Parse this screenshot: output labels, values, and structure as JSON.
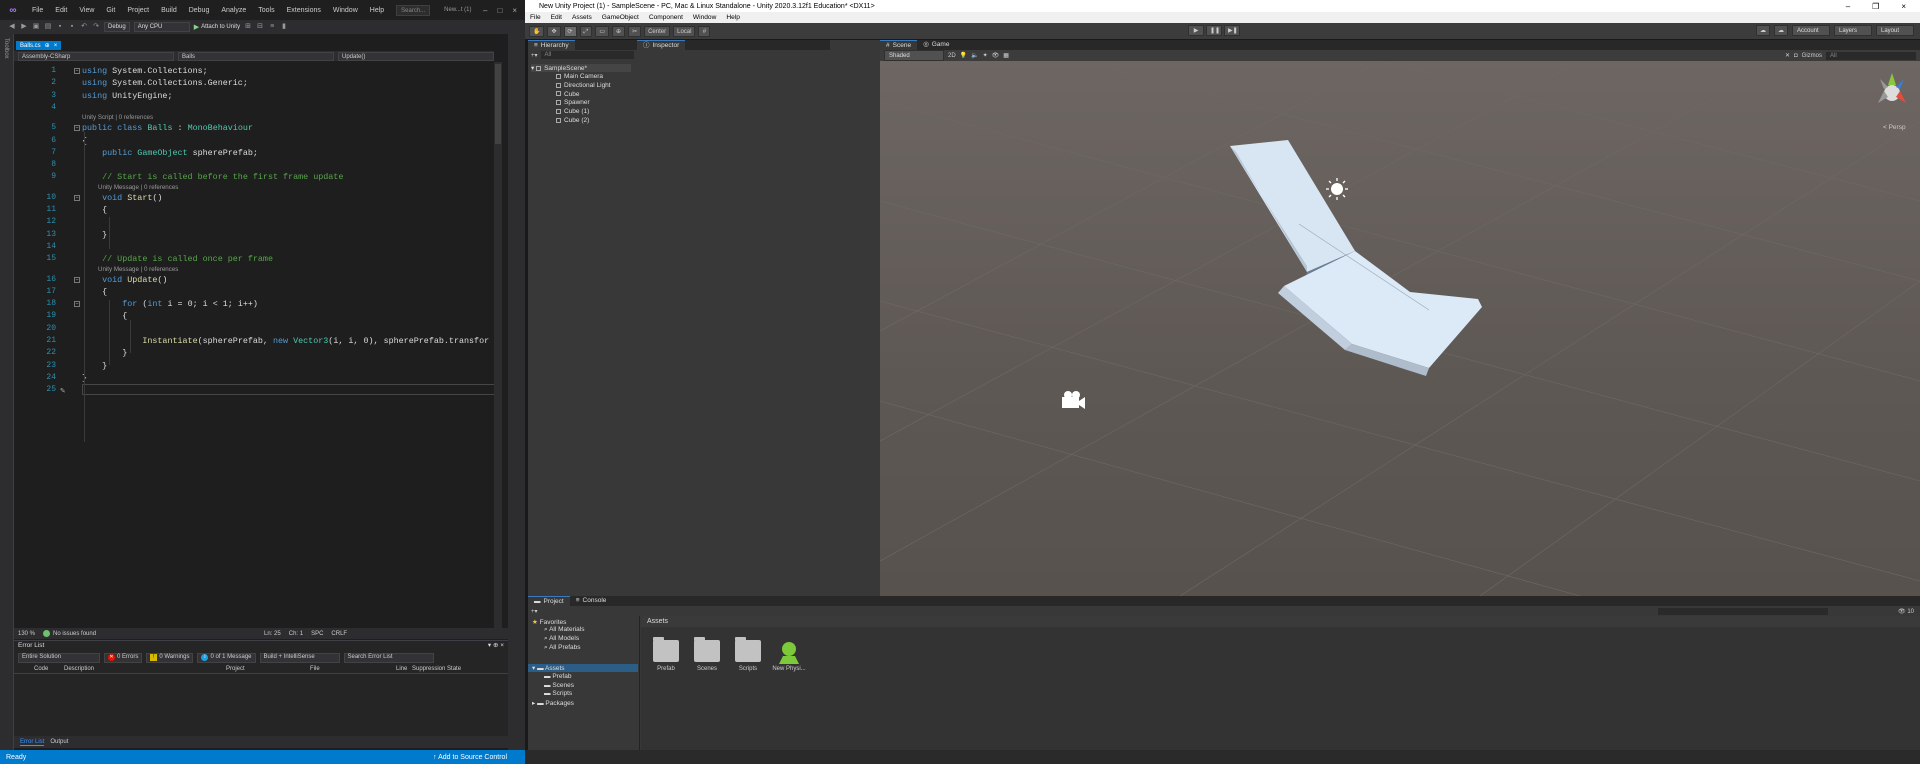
{
  "vs": {
    "menu": [
      "File",
      "Edit",
      "View",
      "Git",
      "Project",
      "Build",
      "Debug",
      "Analyze",
      "Tools",
      "Extensions",
      "Window",
      "Help"
    ],
    "search_placeholder": "Search...",
    "window_title": "New...t (1)",
    "toolbar": {
      "config": "Debug",
      "platform": "Any CPU",
      "attach": "Attach to Unity"
    },
    "sidestrip_label": "Toolbox",
    "tab": {
      "label": "Balls.cs",
      "close": "×"
    },
    "nav": {
      "project": "Assembly-CSharp",
      "class": "Balls",
      "member": "Update()"
    },
    "lines": [
      {
        "n": "1",
        "code": [
          {
            "c": "kw",
            "t": "using "
          },
          {
            "c": "",
            "t": "System.Collections;"
          }
        ]
      },
      {
        "n": "2",
        "code": [
          {
            "c": "kw",
            "t": "using "
          },
          {
            "c": "",
            "t": "System.Collections.Generic;"
          }
        ]
      },
      {
        "n": "3",
        "code": [
          {
            "c": "kw",
            "t": "using "
          },
          {
            "c": "",
            "t": "UnityEngine;"
          }
        ]
      },
      {
        "n": "4",
        "code": []
      },
      {
        "n": "5",
        "code": [
          {
            "c": "kw",
            "t": "public class "
          },
          {
            "c": "ty",
            "t": "Balls"
          },
          {
            "c": "",
            "t": " : "
          },
          {
            "c": "ty",
            "t": "MonoBehaviour"
          }
        ]
      },
      {
        "n": "6",
        "code": [
          {
            "c": "",
            "t": "{"
          }
        ]
      },
      {
        "n": "7",
        "code": [
          {
            "c": "",
            "t": "    "
          },
          {
            "c": "kw",
            "t": "public "
          },
          {
            "c": "ty",
            "t": "GameObject"
          },
          {
            "c": "",
            "t": " spherePrefab;"
          }
        ]
      },
      {
        "n": "8",
        "code": []
      },
      {
        "n": "9",
        "code": [
          {
            "c": "",
            "t": "    "
          },
          {
            "c": "cm",
            "t": "// Start is called before the first frame update"
          }
        ]
      },
      {
        "n": "10",
        "code": [
          {
            "c": "",
            "t": "    "
          },
          {
            "c": "kw",
            "t": "void "
          },
          {
            "c": "fn",
            "t": "Start"
          },
          {
            "c": "",
            "t": "()"
          }
        ]
      },
      {
        "n": "11",
        "code": [
          {
            "c": "",
            "t": "    {"
          }
        ]
      },
      {
        "n": "12",
        "code": []
      },
      {
        "n": "13",
        "code": [
          {
            "c": "",
            "t": "    }"
          }
        ]
      },
      {
        "n": "14",
        "code": []
      },
      {
        "n": "15",
        "code": [
          {
            "c": "",
            "t": "    "
          },
          {
            "c": "cm",
            "t": "// Update is called once per frame"
          }
        ]
      },
      {
        "n": "16",
        "code": [
          {
            "c": "",
            "t": "    "
          },
          {
            "c": "kw",
            "t": "void "
          },
          {
            "c": "fn",
            "t": "Update"
          },
          {
            "c": "",
            "t": "()"
          }
        ]
      },
      {
        "n": "17",
        "code": [
          {
            "c": "",
            "t": "    {"
          }
        ]
      },
      {
        "n": "18",
        "code": [
          {
            "c": "",
            "t": "        "
          },
          {
            "c": "kw",
            "t": "for "
          },
          {
            "c": "",
            "t": "("
          },
          {
            "c": "kw",
            "t": "int"
          },
          {
            "c": "",
            "t": " i = 0; i < 1; i++)"
          }
        ]
      },
      {
        "n": "19",
        "code": [
          {
            "c": "",
            "t": "        {"
          }
        ]
      },
      {
        "n": "20",
        "code": []
      },
      {
        "n": "21",
        "code": [
          {
            "c": "",
            "t": "            "
          },
          {
            "c": "fn",
            "t": "Instantiate"
          },
          {
            "c": "",
            "t": "(spherePrefab, "
          },
          {
            "c": "kw",
            "t": "new "
          },
          {
            "c": "ty",
            "t": "Vector3"
          },
          {
            "c": "",
            "t": "(i, i, 0), spherePrefab.transfor"
          }
        ]
      },
      {
        "n": "22",
        "code": [
          {
            "c": "",
            "t": "        }"
          }
        ]
      },
      {
        "n": "23",
        "code": [
          {
            "c": "",
            "t": "    }"
          }
        ]
      },
      {
        "n": "24",
        "code": [
          {
            "c": "",
            "t": "}"
          }
        ]
      },
      {
        "n": "25",
        "code": []
      }
    ],
    "lens": {
      "class": "Unity Script | 0 references",
      "start": "Unity Message | 0 references",
      "update": "Unity Message | 0 references"
    },
    "status2": {
      "zoom": "130 %",
      "issues": "No issues found",
      "ln": "Ln: 25",
      "ch": "Ch: 1",
      "spc": "SPC",
      "crlf": "CRLF"
    },
    "errorlist": {
      "title": "Error List",
      "scope": "Entire Solution",
      "errors": "0 Errors",
      "warnings": "0 Warnings",
      "messages": "0 of 1 Message",
      "build": "Build + IntelliSense",
      "search": "Search Error List",
      "columns": [
        "Code",
        "Description",
        "Project",
        "File",
        "Line",
        "Suppression State"
      ]
    },
    "bottom_tabs": [
      "Error List",
      "Output"
    ],
    "status": {
      "ready": "Ready",
      "source_control": "Add to Source Control"
    }
  },
  "unity": {
    "title": "New Unity Project (1) - SampleScene - PC, Mac & Linux Standalone - Unity 2020.3.12f1 Education* <DX11>",
    "menu": [
      "File",
      "Edit",
      "Assets",
      "GameObject",
      "Component",
      "Window",
      "Help"
    ],
    "toolbar": {
      "pivot": "Center",
      "space": "Local",
      "account": "Account",
      "layers": "Layers",
      "layout": "Layout"
    },
    "hierarchy": {
      "tab": "Hierarchy",
      "search": "All",
      "scene": "SampleScene*",
      "items": [
        "Main Camera",
        "Directional Light",
        "Cube",
        "Spawner",
        "Cube (1)",
        "Cube (2)"
      ]
    },
    "inspector": {
      "tab": "Inspector"
    },
    "scene": {
      "tabs": [
        "Scene",
        "Game"
      ],
      "shading": "Shaded",
      "mode2d": "2D",
      "gizmos": "Gizmos",
      "search": "All",
      "persp": "< Persp"
    },
    "project": {
      "tabs": [
        "Project",
        "Console"
      ],
      "favorites": "Favorites",
      "fav_items": [
        "All Materials",
        "All Models",
        "All Prefabs"
      ],
      "assets": "Assets",
      "asset_folders": [
        "Prefab",
        "Scenes",
        "Scripts"
      ],
      "packages": "Packages",
      "header": "Assets",
      "grid": [
        "Prefab",
        "Scenes",
        "Scripts",
        "New Physi..."
      ],
      "count": "10"
    }
  }
}
